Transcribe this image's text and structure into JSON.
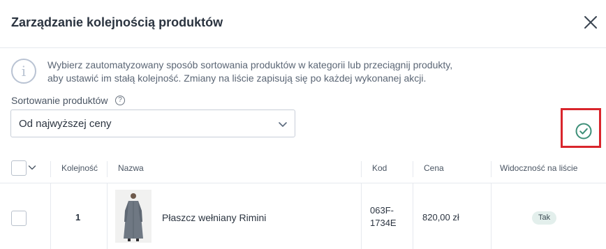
{
  "dialog": {
    "title": "Zarządzanie kolejnością produktów",
    "close_icon": "close-icon"
  },
  "info": {
    "icon": "info-icon",
    "text_line1": "Wybierz zautomatyzowany sposób sortowania produktów w kategorii lub przeciągnij produkty,",
    "text_line2": "aby ustawić im stałą kolejność. Zmiany na liście zapisują się po każdej wykonanej akcji."
  },
  "sorting": {
    "label": "Sortowanie produktów",
    "help_glyph": "?",
    "selected": "Od najwyższej ceny"
  },
  "confirm": {
    "icon": "check-circle-icon",
    "color": "#3d8f78",
    "highlight_color": "#d9252c"
  },
  "table": {
    "columns": {
      "order": "Kolejność",
      "name": "Nazwa",
      "code": "Kod",
      "price": "Cena",
      "visibility": "Widoczność na liście"
    },
    "rows": [
      {
        "order": "1",
        "name": "Płaszcz wełniany Rimini",
        "code_line1": "063F-",
        "code_line2": "1734E",
        "price": "820,00 zł",
        "visibility": "Tak"
      }
    ]
  }
}
